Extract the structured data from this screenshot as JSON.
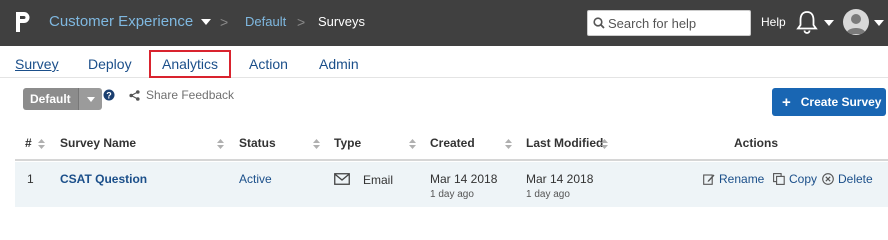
{
  "header": {
    "workspace": "Customer Experience",
    "breadcrumb": {
      "separator": ">",
      "parent": "Default",
      "current": "Surveys"
    },
    "search": {
      "placeholder": "Search for help",
      "value": ""
    },
    "help_label": "Help",
    "icons": {
      "logo": "logo-icon",
      "search": "search-icon",
      "bell": "bell-icon",
      "avatar": "user-avatar"
    }
  },
  "nav": {
    "items": [
      {
        "label": "Survey",
        "active": true
      },
      {
        "label": "Deploy"
      },
      {
        "label": "Analytics",
        "highlighted": true
      },
      {
        "label": "Action"
      },
      {
        "label": "Admin"
      }
    ]
  },
  "toolbar": {
    "view_select": "Default",
    "share_label": "Share Feedback",
    "create_label": "Create Survey",
    "create_icon": "plus-icon"
  },
  "table": {
    "headers": [
      "#",
      "Survey Name",
      "Status",
      "Type",
      "Created",
      "Last Modified",
      "Actions"
    ],
    "rows": [
      {
        "num": "1",
        "name": "CSAT Question",
        "status": "Active",
        "type": "Email",
        "created_date": "Mar 14 2018",
        "created_ago": "1 day ago",
        "modified_date": "Mar 14 2018",
        "modified_ago": "1 day ago",
        "actions": [
          "Rename",
          "Copy",
          "Delete"
        ]
      }
    ]
  },
  "colors": {
    "topbar": "#404040",
    "link": "#1b4f8a",
    "workspace": "#7fb8e0",
    "primary_button": "#1966b3",
    "highlight_box": "#d9232e",
    "row_bg": "#eef4f7"
  }
}
